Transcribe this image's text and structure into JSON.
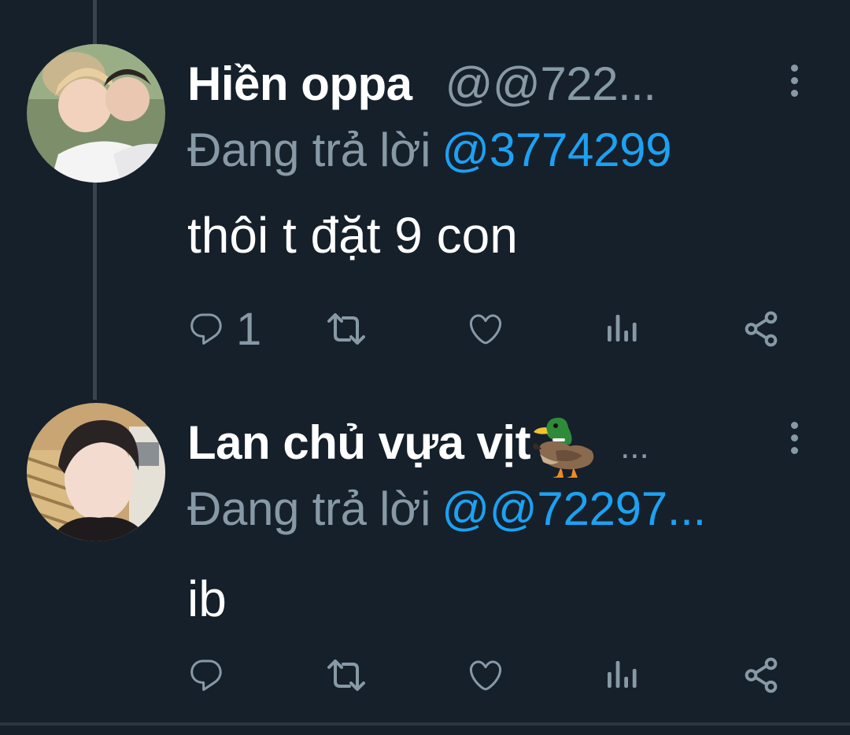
{
  "tweets": [
    {
      "display_name": "Hiền oppa",
      "handle": "@@722...",
      "reply_label": "Đang trả lời",
      "reply_mention": "@3774299",
      "text": "thôi t đặt 9 con",
      "reply_count": "1",
      "avatar_icon": "avatar-photo"
    },
    {
      "display_name": "Lan chủ vựa vịt",
      "name_emoji_icon": "duck-emoji-icon",
      "name_overflow": "...",
      "reply_label": "Đang trả lời",
      "reply_mention": "@@72297...",
      "text": "ib",
      "reply_count": "",
      "avatar_icon": "avatar-photo"
    }
  ],
  "icons": {
    "reply": "reply-icon",
    "retweet": "retweet-icon",
    "like": "heart-icon",
    "views": "analytics-icon",
    "share": "share-icon",
    "more": "more-vertical-icon"
  },
  "colors": {
    "background": "#15202b",
    "text_primary": "#ffffff",
    "text_secondary": "#8899a6",
    "link": "#1da1f2",
    "thread_line": "#38444d"
  }
}
